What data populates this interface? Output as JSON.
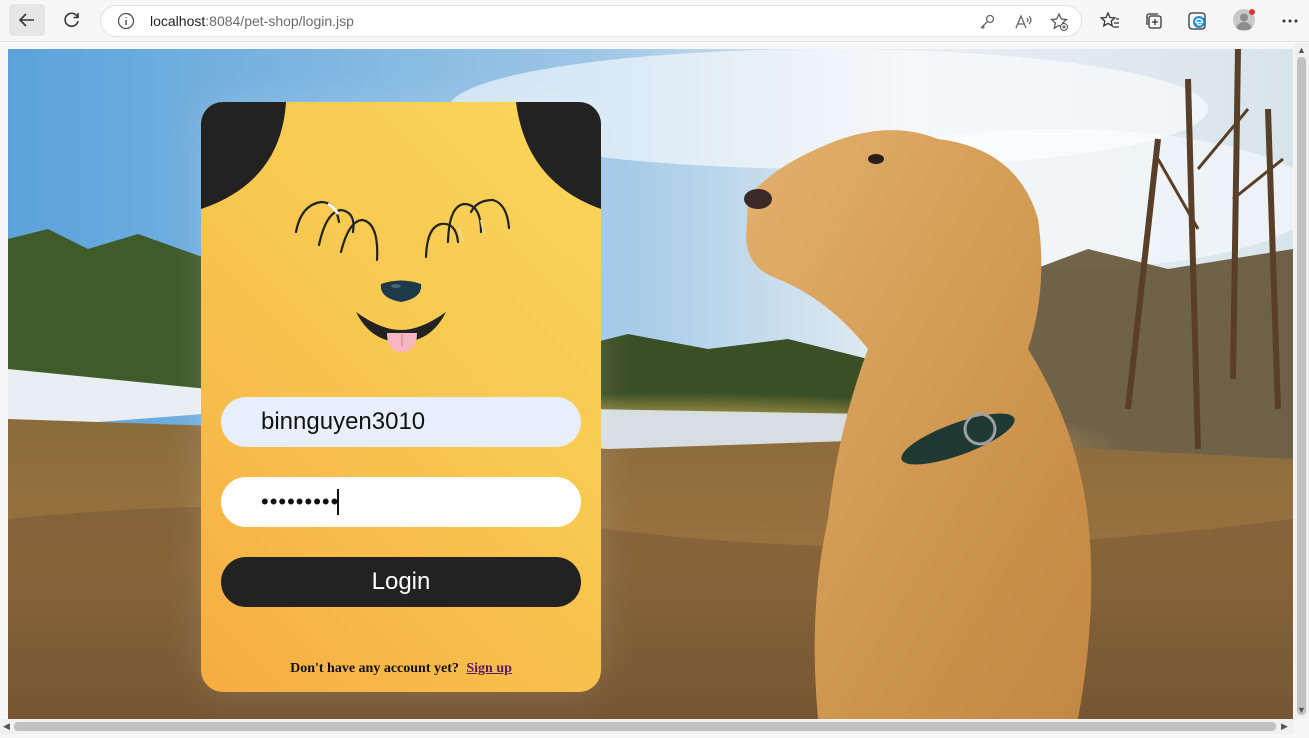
{
  "browser": {
    "url_host": "localhost",
    "url_rest": ":8084/pet-shop/login.jsp",
    "icons": [
      "back-arrow-icon",
      "reload-icon",
      "info-icon",
      "key-icon",
      "read-aloud-icon",
      "add-favorite-icon",
      "favorites-icon",
      "collections-icon",
      "edge-icon",
      "profile-icon",
      "more-icon"
    ]
  },
  "login": {
    "username_value": "binnguyen3010",
    "password_value": "•••••••••",
    "login_label": "Login",
    "signup_prompt": "Don't have any account yet?",
    "signup_link": "Sign up"
  },
  "colors": {
    "card_top": "#f9d75a",
    "card_bottom": "#f6ad42",
    "button": "#222222",
    "ears": "#222222",
    "link": "#5b1a6b"
  }
}
